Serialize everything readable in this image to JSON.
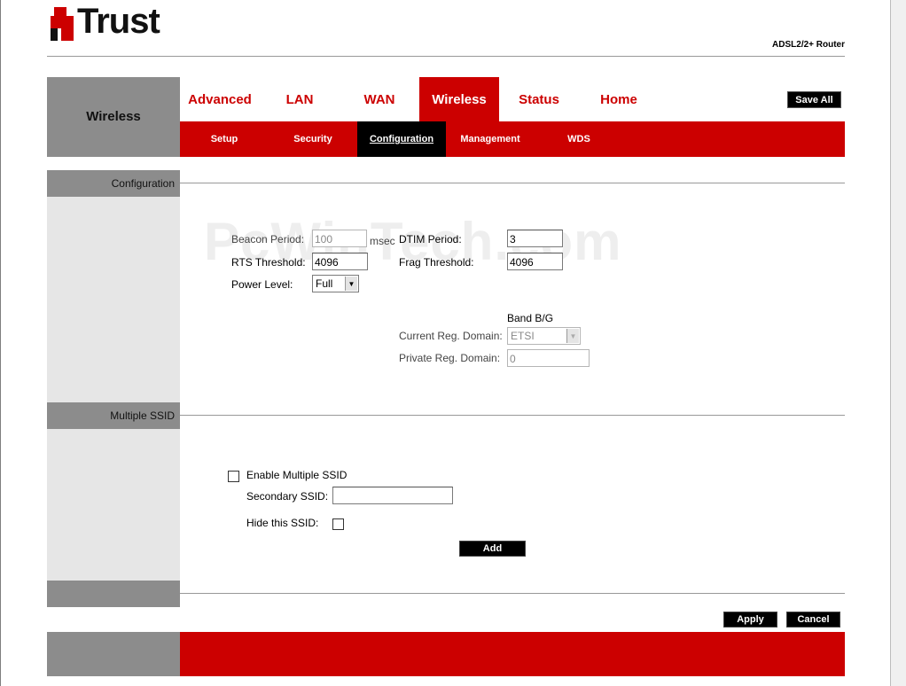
{
  "brand": {
    "logo_text": "Trust",
    "product": "ADSL2/2+ Router"
  },
  "header": {
    "section_title": "Wireless",
    "nav": [
      {
        "label": "Advanced",
        "active": false
      },
      {
        "label": "LAN",
        "active": false
      },
      {
        "label": "WAN",
        "active": false
      },
      {
        "label": "Wireless",
        "active": true
      },
      {
        "label": "Status",
        "active": false
      },
      {
        "label": "Home",
        "active": false
      }
    ],
    "save_all": "Save All",
    "subnav": [
      {
        "label": "Setup",
        "active": false
      },
      {
        "label": "Security",
        "active": false
      },
      {
        "label": "Configuration",
        "active": true
      },
      {
        "label": "Management",
        "active": false
      },
      {
        "label": "WDS",
        "active": false
      }
    ]
  },
  "configuration": {
    "section_label": "Configuration",
    "beacon_period": {
      "label": "Beacon Period:",
      "value": "100",
      "unit": "msec"
    },
    "dtim_period": {
      "label": "DTIM Period:",
      "value": "3"
    },
    "rts_threshold": {
      "label": "RTS Threshold:",
      "value": "4096"
    },
    "frag_threshold": {
      "label": "Frag Threshold:",
      "value": "4096"
    },
    "power_level": {
      "label": "Power Level:",
      "value": "Full"
    },
    "band_label": "Band B/G",
    "current_reg_domain": {
      "label": "Current Reg. Domain:",
      "value": "ETSI"
    },
    "private_reg_domain": {
      "label": "Private Reg. Domain:",
      "value": "0"
    }
  },
  "multiple_ssid": {
    "section_label": "Multiple SSID",
    "enable_label": "Enable Multiple SSID",
    "secondary_ssid_label": "Secondary SSID:",
    "secondary_ssid_value": "",
    "hide_label": "Hide this SSID:",
    "add_button": "Add"
  },
  "actions": {
    "apply": "Apply",
    "cancel": "Cancel"
  },
  "watermark": "PcWinTech.com",
  "colors": {
    "brand_red": "#cc0000",
    "sidebar_grey": "#8c8c8c",
    "sidebar_light": "#e6e6e6"
  }
}
